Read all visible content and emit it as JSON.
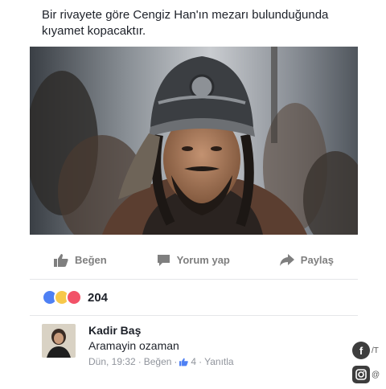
{
  "post": {
    "caption": "Bir rivayete göre Cengiz Han'ın mezarı bulunduğunda kıyamet kopacaktır."
  },
  "actions": {
    "like_label": "Beğen",
    "comment_label": "Yorum yap",
    "share_label": "Paylaş"
  },
  "reactions": {
    "count": "204",
    "types": [
      "like",
      "haha",
      "love"
    ]
  },
  "comment": {
    "author": "Kadir Baş",
    "text": "Aramayin ozaman",
    "time": "Dün, 19:32",
    "like_label": "Beğen",
    "like_count": "4",
    "reply_label": "Yanıtla"
  },
  "watermark": {
    "facebook_handle": "/T",
    "instagram_handle": "@"
  },
  "colors": {
    "action_gray": "#7f7f7f",
    "meta_gray": "#90949c",
    "like_blue": "#4e80f4",
    "haha_yellow": "#f7c84a",
    "love_red": "#f25268"
  }
}
